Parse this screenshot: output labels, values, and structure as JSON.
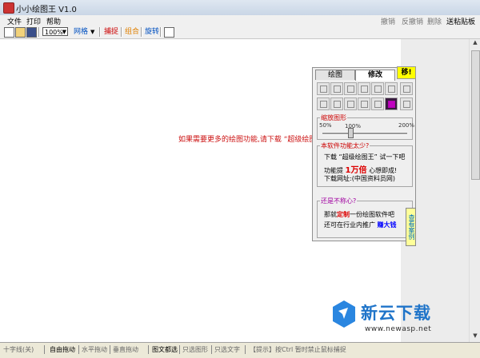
{
  "window": {
    "title": "小小绘图王 V1.0"
  },
  "menubar": {
    "left": [
      "文件",
      "打印",
      "帮助"
    ],
    "right": [
      "撤销",
      "反撤销",
      "删除",
      "送粘贴板"
    ]
  },
  "toolbar": {
    "zoom": "100%",
    "grid": "网格",
    "capture": "捕捉",
    "combine": "组合",
    "rotate": "旋转",
    "colors": {
      "capture": "#cc0000",
      "combine": "#e08000",
      "rotate": "#0050c0",
      "grid": "#0050c0"
    }
  },
  "canvas": {
    "hint": "如果需要更多的绘图功能,请下载 “超级绘图王”"
  },
  "panel": {
    "tabs": [
      "绘图",
      "修改"
    ],
    "move_button": "移!",
    "zoom_group": {
      "legend": "缩放图形",
      "min": "50%",
      "mid": "100%",
      "max": "200%",
      "value_percent": 100
    },
    "small_group": {
      "legend": "本软件功能太少?",
      "line1": "下载 “超级绘图王” 试一下吧",
      "line2_prefix": "功能提",
      "line2_highlight": "1万倍",
      "line2_suffix": "心想即成!",
      "line3": "下载网址:(中国资料员网)"
    },
    "unsatisfied_group": {
      "legend": "还是不称心?",
      "line1_prefix": "那就",
      "line1_highlight": "定制",
      "line1_suffix": "一份绘图软件吧",
      "line2_prefix": "还可在行业内推广",
      "line2_highlight": "赚大钱",
      "side_button": "查看案例"
    }
  },
  "statusbar": {
    "items": [
      "十字线(关)",
      "自由拖动",
      "水平拖动",
      "垂直拖动",
      "图文都选",
      "只选图形",
      "只选文字",
      "【提示】按Ctrl 暂时禁止鼠标捕捉"
    ]
  },
  "watermark": {
    "brand": "新云下载",
    "url": "www.newasp.net"
  }
}
